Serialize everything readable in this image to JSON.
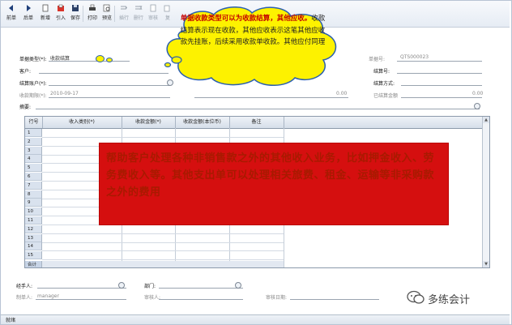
{
  "toolbar": {
    "items": [
      {
        "label": "前单",
        "icon": "prev-arrow-icon",
        "enabled": true
      },
      {
        "label": "后单",
        "icon": "next-arrow-icon",
        "enabled": true
      },
      {
        "label": "新增",
        "icon": "new-doc-icon",
        "enabled": true
      },
      {
        "label": "引入",
        "icon": "import-icon",
        "enabled": true
      },
      {
        "label": "保存",
        "icon": "save-icon",
        "enabled": true
      },
      {
        "label": "打印",
        "icon": "print-icon",
        "enabled": true
      },
      {
        "label": "预览",
        "icon": "preview-icon",
        "enabled": true
      },
      {
        "label": "插行",
        "icon": "insert-row-icon",
        "enabled": false
      },
      {
        "label": "删行",
        "icon": "delete-row-icon",
        "enabled": false
      },
      {
        "label": "审核",
        "icon": "audit-icon",
        "enabled": false
      },
      {
        "label": "复",
        "icon": "copy-icon",
        "enabled": false
      }
    ]
  },
  "form": {
    "doc_type_label": "单据类型(*):",
    "doc_type_value": "收款结算",
    "customer_label": "客户:",
    "account_label": "结算账户(*):",
    "date_label": "收款期限(*):",
    "date_value": "2010-09-17",
    "order_no_label": "单据号:",
    "order_no_value": "QTS000023",
    "settle_no_label": "结算号:",
    "settle_method_label": "结算方式:",
    "amount_mid_value": "0.00",
    "settled_label": "已结算金额",
    "settled_value": "0.00",
    "summary_label": "摘要:"
  },
  "grid": {
    "columns": [
      "行号",
      "收入类别(*)",
      "收款金额(*)",
      "收款金额(本位币)",
      "备注"
    ],
    "rows": [
      "1",
      "2",
      "3",
      "4",
      "5",
      "6",
      "7",
      "8",
      "9",
      "10",
      "11",
      "12",
      "13",
      "14",
      "15"
    ],
    "total_label": "合计"
  },
  "footer": {
    "handler_label": "经手人:",
    "dept_label": "部门:",
    "maker_label": "制单人:",
    "maker_value": "manager",
    "auditor_label": "审核人:",
    "audit_date_label": "审核日期:"
  },
  "callout": {
    "bold_text": "单据收款类型可以为收款结算，其他应收。",
    "text": "收款结算表示现在收款，其他应收表示这笔其他应收款先挂账，后续采用收款单收款。其他应付同理"
  },
  "red_note": {
    "text": "帮助客户处理各种非销售款之外的其他收入业务，比如押金收入、劳务费收入等。其他支出单可以处理相关旅费、租金、运输等非采购款之外的费用"
  },
  "watermark": {
    "text": "多练会计"
  },
  "status": {
    "text": "就绪"
  },
  "colors": {
    "callout_fill": "#fdf200",
    "callout_border": "#2a5fb0",
    "red_box": "#d50f0f",
    "grid_header": "#d6dfea"
  }
}
